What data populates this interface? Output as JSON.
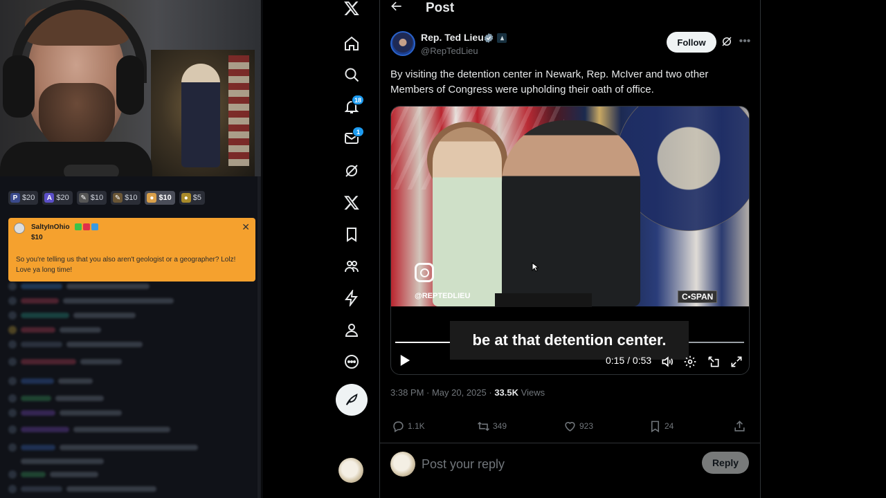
{
  "stream": {
    "donor_tags": [
      {
        "badge": "P",
        "badge_color": "#3a4a8c",
        "amount": "$20"
      },
      {
        "badge": "A",
        "badge_color": "#5b4fc8",
        "amount": "$20"
      },
      {
        "badge": "✎",
        "badge_color": "#555555",
        "amount": "$10"
      },
      {
        "badge": "✎",
        "badge_color": "#6a5636",
        "amount": "$10"
      },
      {
        "badge": "●",
        "badge_color": "#d9a04a",
        "amount": "$10"
      },
      {
        "badge": "●",
        "badge_color": "#a88a2a",
        "amount": "$5"
      }
    ],
    "donation": {
      "name": "SaltyInOhio",
      "amount": "$10",
      "message": "So you're telling us that you also aren't geologist or a geographer? Lolz! Love ya long time!",
      "card_color": "#f5a12e"
    }
  },
  "sidebar": {
    "notifications_count": "18",
    "messages_count": "1"
  },
  "header": {
    "title": "Post"
  },
  "post": {
    "author_name": "Rep. Ted Lieu",
    "author_handle": "@RepTedLieu",
    "follow_label": "Follow",
    "text": "By visiting the detention center in Newark, Rep. McIver and two other Members of Congress were upholding their oath of office.",
    "video": {
      "watermark": "@REPTEDLIEU",
      "network_bug": "C•SPAN",
      "caption": "be at that detention center.",
      "current_time": "0:15",
      "duration": "0:53",
      "progress": 0.17
    },
    "timestamp": "3:38 PM · May 20, 2025 ·",
    "views_count": "33.5K",
    "views_label": "Views",
    "stats": {
      "replies": "1.1K",
      "reposts": "349",
      "likes": "923",
      "bookmarks": "24"
    }
  },
  "reply": {
    "placeholder": "Post your reply",
    "button_label": "Reply"
  },
  "colors": {
    "accent": "#1d9bf0",
    "background": "#000000",
    "text_primary": "#e7e9ea",
    "text_secondary": "#71767b"
  }
}
